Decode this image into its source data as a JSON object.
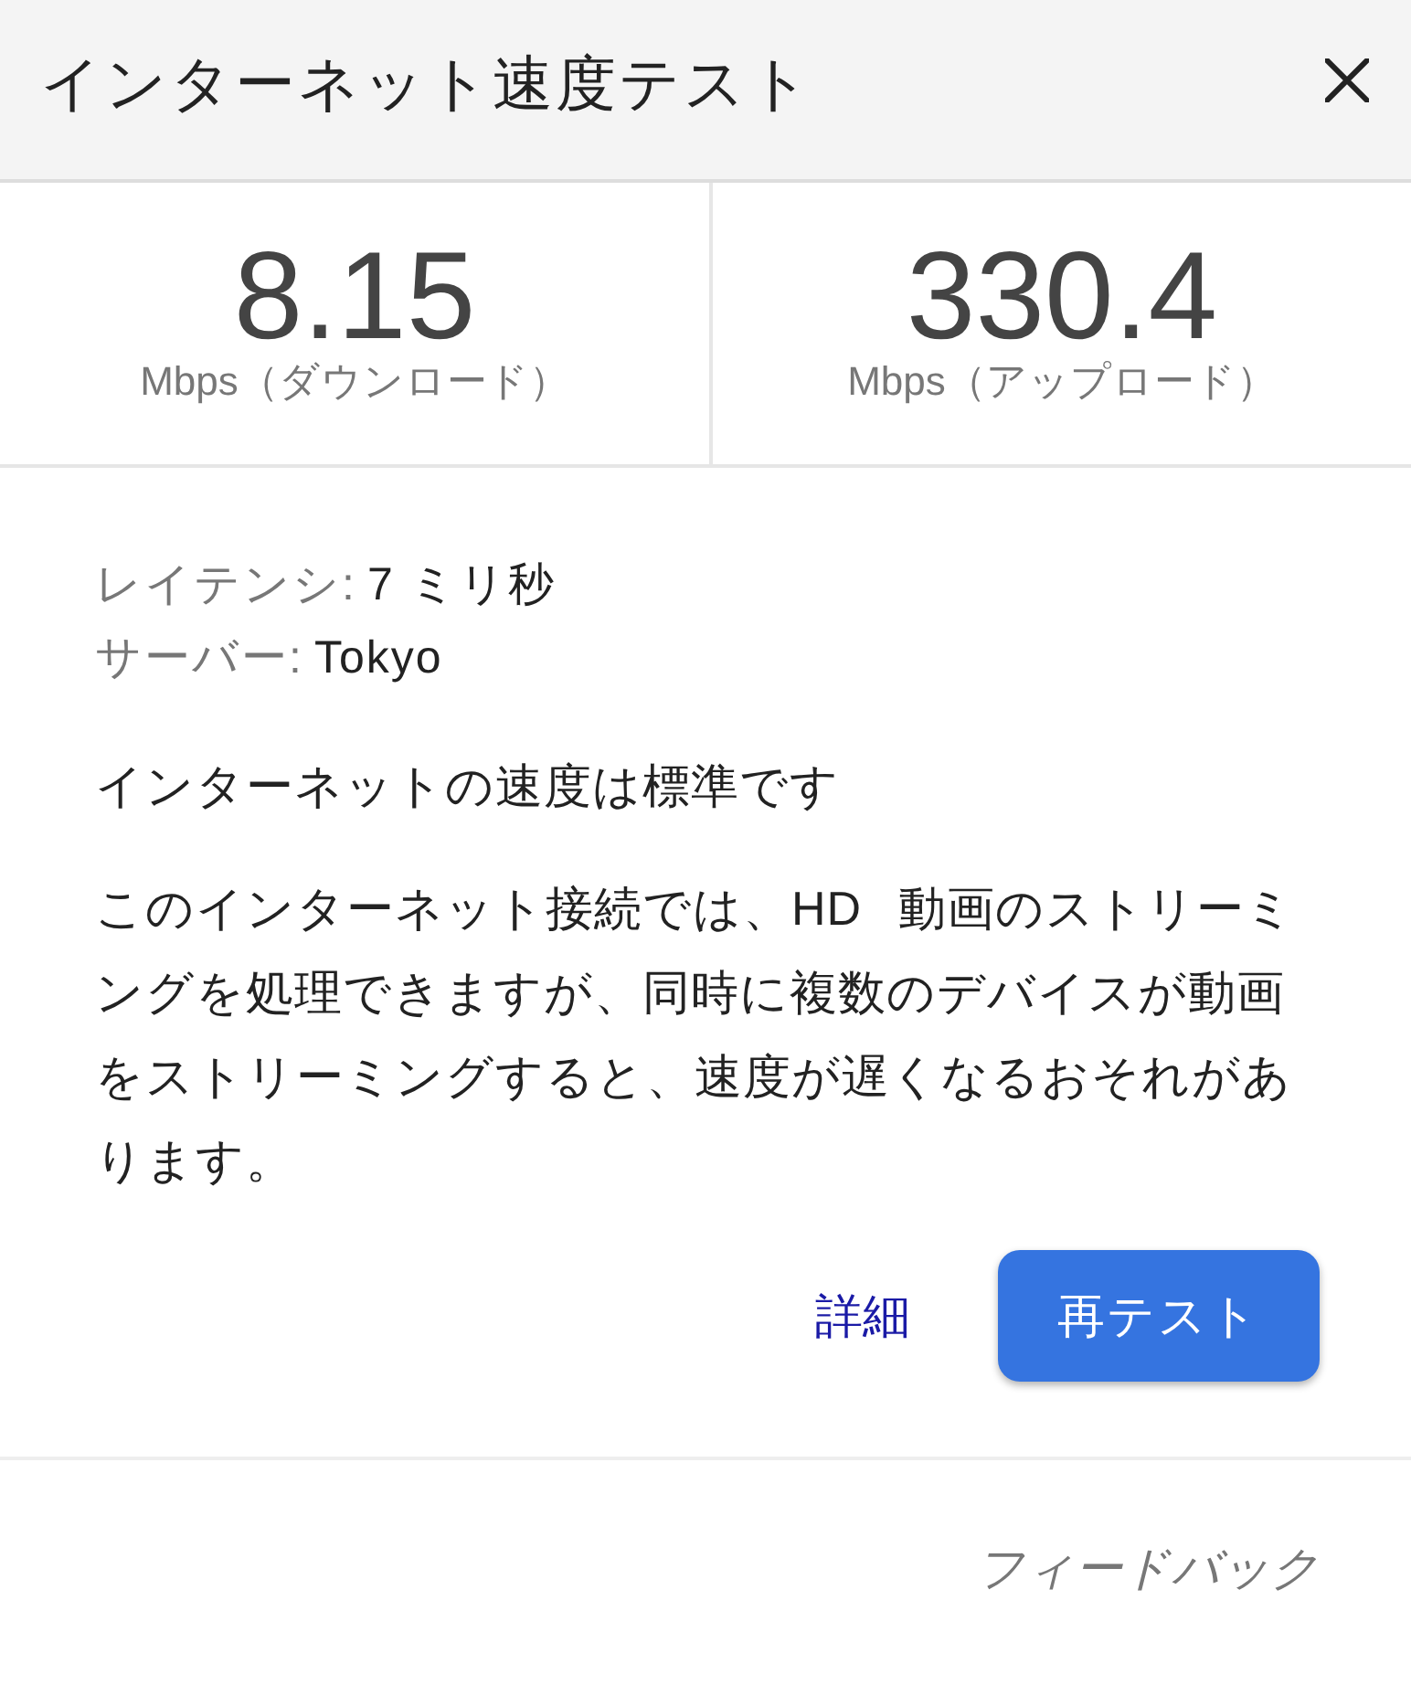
{
  "dialog": {
    "title": "インターネット速度テスト"
  },
  "results": [
    {
      "value": "8.15",
      "label": "Mbps（ダウンロード）"
    },
    {
      "value": "330.4",
      "label": "Mbps（アップロード）"
    }
  ],
  "details": [
    {
      "label": "レイテンシ:",
      "value": "7 ミリ秒"
    },
    {
      "label": "サーバー:",
      "value": "Tokyo"
    }
  ],
  "verdict": "インターネットの速度は標準です",
  "description": "このインターネット接続では、HD 動画のストリーミングを処理できますが、同時に複数のデバイスが動画をストリーミングすると、速度が遅くなるおそれがあります。",
  "actions": [
    {
      "kind": "link",
      "label": "詳細"
    },
    {
      "kind": "primary",
      "label": "再テスト"
    }
  ],
  "footer": {
    "feedback_link": "フィードバック"
  }
}
